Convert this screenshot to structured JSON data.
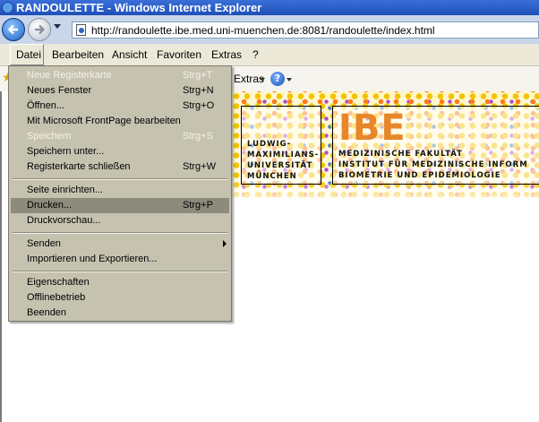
{
  "window": {
    "title": "RANDOULETTE - Windows Internet Explorer"
  },
  "address": {
    "url": "http://randoulette.ibe.med.uni-muenchen.de:8081/randoulette/index.html"
  },
  "menubar": {
    "items": [
      "Datei",
      "Bearbeiten",
      "Ansicht",
      "Favoriten",
      "Extras",
      "?"
    ],
    "active": "Datei"
  },
  "toolbar": {
    "extras_label": "Extras",
    "help_glyph": "?"
  },
  "file_menu": {
    "items": [
      {
        "label": "Neue Registerkarte",
        "shortcut": "Strg+T",
        "enabled": false
      },
      {
        "label": "Neues Fenster",
        "shortcut": "Strg+N",
        "enabled": true
      },
      {
        "label": "Öffnen...",
        "shortcut": "Strg+O",
        "enabled": true
      },
      {
        "label": "Mit Microsoft FrontPage bearbeiten",
        "shortcut": "",
        "enabled": true
      },
      {
        "label": "Speichern",
        "shortcut": "Strg+S",
        "enabled": false
      },
      {
        "label": "Speichern unter...",
        "shortcut": "",
        "enabled": true
      },
      {
        "label": "Registerkarte schließen",
        "shortcut": "Strg+W",
        "enabled": true
      },
      {
        "label": "Seite einrichten...",
        "shortcut": "",
        "enabled": true
      },
      {
        "label": "Drucken...",
        "shortcut": "Strg+P",
        "enabled": true,
        "highlighted": true
      },
      {
        "label": "Druckvorschau...",
        "shortcut": "",
        "enabled": true
      },
      {
        "label": "Senden",
        "shortcut": "",
        "enabled": true,
        "submenu": true
      },
      {
        "label": "Importieren und Exportieren...",
        "shortcut": "",
        "enabled": true
      },
      {
        "label": "Eigenschaften",
        "shortcut": "",
        "enabled": true
      },
      {
        "label": "Offlinebetrieb",
        "shortcut": "",
        "enabled": true
      },
      {
        "label": "Beenden",
        "shortcut": "",
        "enabled": true
      }
    ]
  },
  "banner": {
    "lmu_lines": [
      "LUDWIG-",
      "MAXIMILIANS-",
      "UNIVERSITÄT",
      "MÜNCHEN"
    ],
    "logo": "IBE",
    "faculty_lines": [
      "MEDIZINISCHE FAKULTÄT",
      "INSTITUT FÜR MEDIZINISCHE INFORM",
      "BIOMETRIE UND EPIDEMIOLOGIE"
    ]
  },
  "colors": {
    "titlebar": "#1e4fb8",
    "menu_bg": "#c6c2b0",
    "menu_highlight": "#8d8b7b",
    "ibe_orange": "#e8862a"
  }
}
